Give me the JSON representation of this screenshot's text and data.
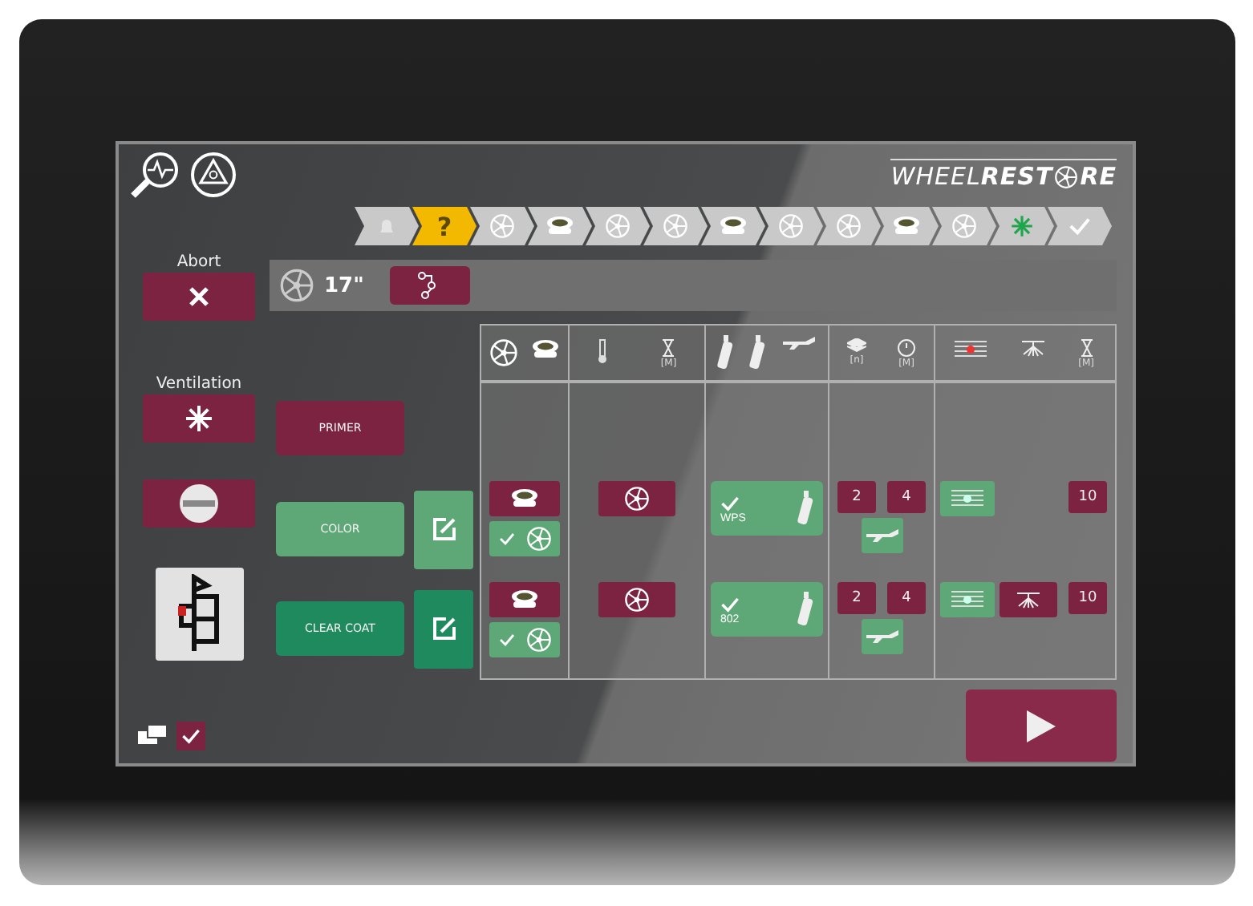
{
  "logo": {
    "text": "WHEEL**REST**",
    "suffix": "RE"
  },
  "steps": [
    {
      "kind": "home",
      "selected": false
    },
    {
      "kind": "help",
      "label": "?",
      "selected": true
    },
    {
      "kind": "wheel",
      "selected": false
    },
    {
      "kind": "bowl",
      "selected": false
    },
    {
      "kind": "wheel",
      "selected": false
    },
    {
      "kind": "wheel",
      "selected": false
    },
    {
      "kind": "bowl",
      "selected": false
    },
    {
      "kind": "wheel",
      "selected": false
    },
    {
      "kind": "wheel",
      "selected": false
    },
    {
      "kind": "bowl",
      "selected": false
    },
    {
      "kind": "wheel",
      "selected": false
    },
    {
      "kind": "vent",
      "selected": false
    },
    {
      "kind": "done",
      "selected": false
    }
  ],
  "abort": {
    "label": "Abort"
  },
  "ventilation": {
    "label": "Ventilation"
  },
  "wheel_size": "17\"",
  "table_header": {
    "prep_time_unit": "[M]",
    "layers_unit": "[n]",
    "flash_time_unit": "[M]",
    "dry_time_unit": "[M]"
  },
  "processes": [
    {
      "label": "PRIMER",
      "color": "#7d2342"
    },
    {
      "label": "COLOR",
      "color": "#5ea877",
      "editable": true,
      "settings": {
        "wheel_options": [
          {
            "checked": false
          },
          {
            "checked": true
          }
        ],
        "prep_checked": false,
        "paint": {
          "checked": true,
          "label": "WPS"
        },
        "layers": "2",
        "flash_time": "4",
        "gun_on": true,
        "dryer_on": true,
        "dry_time": "10"
      }
    },
    {
      "label": "CLEAR COAT",
      "color": "#1f8a5e",
      "editable": true,
      "settings": {
        "wheel_options": [
          {
            "checked": false
          },
          {
            "checked": true
          }
        ],
        "prep_checked": false,
        "paint": {
          "checked": true,
          "label": "802"
        },
        "layers": "2",
        "flash_time": "4",
        "gun_on": true,
        "dryer_on": true,
        "lamp_on": false,
        "dry_time": "10"
      }
    }
  ],
  "bottom_checkbox": {
    "checked": true
  }
}
